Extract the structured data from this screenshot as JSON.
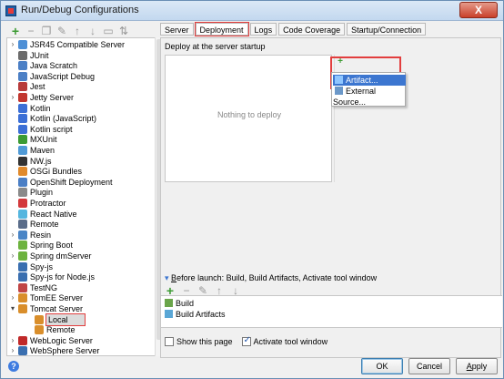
{
  "window": {
    "title": "Run/Debug Configurations",
    "close_label": "X"
  },
  "left_toolbar": {
    "icons": [
      "plus-icon",
      "minus-icon",
      "copy-icon",
      "wrench-icon",
      "arrow-up-icon",
      "arrow-down-icon",
      "folder-icon",
      "sort-icon"
    ]
  },
  "tree": {
    "items": [
      {
        "label": "JSR45 Compatible Server",
        "icon": "server-icon",
        "arrow": "collapsed",
        "icon_color": "#4d8fd6"
      },
      {
        "label": "JUnit",
        "icon": "junit-icon",
        "arrow": "",
        "icon_color": "#6c6c6c"
      },
      {
        "label": "Java Scratch",
        "icon": "java-scratch-icon",
        "arrow": "",
        "icon_color": "#4b7fc5"
      },
      {
        "label": "JavaScript Debug",
        "icon": "js-debug-icon",
        "arrow": "",
        "icon_color": "#4b7fc5"
      },
      {
        "label": "Jest",
        "icon": "jest-icon",
        "arrow": "",
        "icon_color": "#b73b3b"
      },
      {
        "label": "Jetty Server",
        "icon": "jetty-icon",
        "arrow": "collapsed",
        "icon_color": "#c2362f"
      },
      {
        "label": "Kotlin",
        "icon": "kotlin-icon",
        "arrow": "",
        "icon_color": "#3c6fd6"
      },
      {
        "label": "Kotlin (JavaScript)",
        "icon": "kotlin-js-icon",
        "arrow": "",
        "icon_color": "#3c6fd6"
      },
      {
        "label": "Kotlin script",
        "icon": "kotlin-script-icon",
        "arrow": "",
        "icon_color": "#3c6fd6"
      },
      {
        "label": "MXUnit",
        "icon": "mxunit-icon",
        "arrow": "",
        "icon_color": "#3c9b33"
      },
      {
        "label": "Maven",
        "icon": "maven-icon",
        "arrow": "",
        "icon_color": "#4f9ad6"
      },
      {
        "label": "NW.js",
        "icon": "nwjs-icon",
        "arrow": "",
        "icon_color": "#333333"
      },
      {
        "label": "OSGi Bundles",
        "icon": "osgi-icon",
        "arrow": "",
        "icon_color": "#e08a2c"
      },
      {
        "label": "OpenShift Deployment",
        "icon": "openshift-icon",
        "arrow": "",
        "icon_color": "#4b7fc5"
      },
      {
        "label": "Plugin",
        "icon": "plugin-icon",
        "arrow": "",
        "icon_color": "#8a8a8a"
      },
      {
        "label": "Protractor",
        "icon": "protractor-icon",
        "arrow": "",
        "icon_color": "#d3393c"
      },
      {
        "label": "React Native",
        "icon": "react-icon",
        "arrow": "",
        "icon_color": "#55b6df"
      },
      {
        "label": "Remote",
        "icon": "remote-icon",
        "arrow": "",
        "icon_color": "#5a6d8a"
      },
      {
        "label": "Resin",
        "icon": "resin-icon",
        "arrow": "collapsed",
        "icon_color": "#4a85c6"
      },
      {
        "label": "Spring Boot",
        "icon": "spring-boot-icon",
        "arrow": "",
        "icon_color": "#6db33f"
      },
      {
        "label": "Spring dmServer",
        "icon": "spring-dm-icon",
        "arrow": "collapsed",
        "icon_color": "#6db33f"
      },
      {
        "label": "Spy-js",
        "icon": "spyjs-icon",
        "arrow": "",
        "icon_color": "#3a6fb0"
      },
      {
        "label": "Spy-js for Node.js",
        "icon": "spyjs-node-icon",
        "arrow": "",
        "icon_color": "#3a6fb0"
      },
      {
        "label": "TestNG",
        "icon": "testng-icon",
        "arrow": "",
        "icon_color": "#c04545"
      },
      {
        "label": "TomEE Server",
        "icon": "tomee-icon",
        "arrow": "collapsed",
        "icon_color": "#d98e2b"
      },
      {
        "label": "Tomcat Server",
        "icon": "tomcat-icon",
        "arrow": "expanded",
        "icon_color": "#d98e2b"
      },
      {
        "label": "Local",
        "icon": "tomcat-local-icon",
        "arrow": "",
        "icon_color": "#d98e2b",
        "indent": 2,
        "selected": true
      },
      {
        "label": "Remote",
        "icon": "tomcat-remote-icon",
        "arrow": "",
        "icon_color": "#d98e2b",
        "indent": 2
      },
      {
        "label": "WebLogic Server",
        "icon": "weblogic-icon",
        "arrow": "collapsed",
        "icon_color": "#c02929"
      },
      {
        "label": "WebSphere Server",
        "icon": "websphere-icon",
        "arrow": "collapsed",
        "icon_color": "#3a6fb0"
      }
    ]
  },
  "tabs": [
    {
      "label": "Server",
      "active": false
    },
    {
      "label": "Deployment",
      "active": true
    },
    {
      "label": "Logs",
      "active": false
    },
    {
      "label": "Code Coverage",
      "active": false
    },
    {
      "label": "Startup/Connection",
      "active": false
    }
  ],
  "deployment": {
    "section_label": "Deploy at the server startup",
    "empty_text": "Nothing to deploy",
    "popup_items": [
      {
        "label": "Artifact...",
        "selected": true,
        "icon": "artifact-icon"
      },
      {
        "label": "External Source...",
        "selected": false,
        "icon": "external-source-icon"
      }
    ]
  },
  "before_launch": {
    "label_prefix": "B",
    "label_rest": "efore launch: Build, Build Artifacts, Activate tool window",
    "items": [
      {
        "label": "Build",
        "icon": "build-icon"
      },
      {
        "label": "Build Artifacts",
        "icon": "build-artifacts-icon"
      }
    ]
  },
  "options": {
    "show_page": {
      "label": "Show this page",
      "checked": false
    },
    "activate_tool": {
      "label": "Activate tool window",
      "checked": true
    }
  },
  "buttons": {
    "ok": "OK",
    "cancel": "Cancel",
    "apply_u": "A",
    "apply_rest": "pply"
  }
}
